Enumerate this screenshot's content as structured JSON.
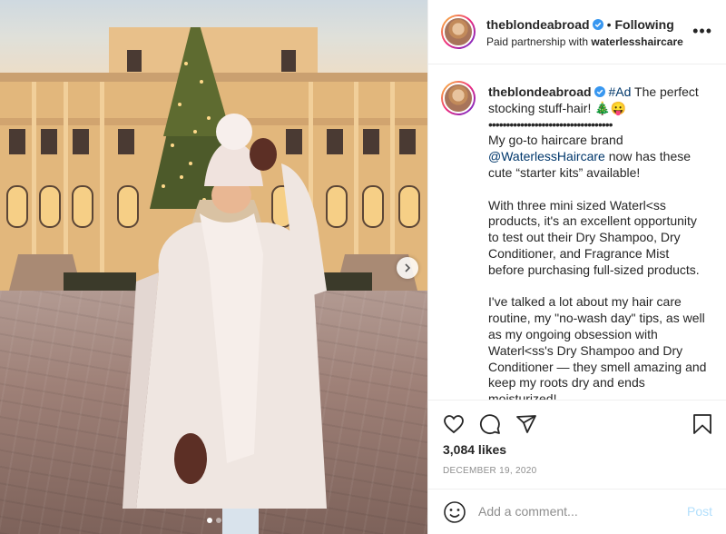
{
  "post": {
    "author": "theblondeabroad",
    "verified_icon": "verified-badge-icon",
    "separator": "•",
    "follow_status": "Following",
    "partnership_prefix": "Paid partnership with",
    "partner": "waterlesshaircare",
    "more_icon": "more-options-icon",
    "more_label": "•••"
  },
  "photo": {
    "icons": [
      "next-arrow-icon"
    ],
    "carousel_dots": 2,
    "active_dot": 0
  },
  "caption": {
    "author": "theblondeabroad",
    "hashtag": "#Ad",
    "line1_rest": " The perfect stocking stuff-hair! 🎄😛",
    "divider": "•••••••••••••••••••••••••••••••••••",
    "p1_before": "My go-to haircare brand ",
    "p1_mention": "@WaterlessHaircare",
    "p1_after": " now has these cute “starter kits” available!",
    "p2": "With three mini sized Waterl<ss products, it's an excellent opportunity to test out their Dry Shampoo, Dry Conditioner, and Fragrance Mist before purchasing full-sized products.",
    "p3": "I've talked a lot about my hair care routine, my \"no-wash day\" tips, as well as my ongoing obsession with Waterl<ss's Dry Shampoo and Dry Conditioner — they smell amazing and keep my roots dry and ends moisturized!"
  },
  "actions": {
    "icons": [
      "like-heart-icon",
      "comment-icon",
      "share-icon",
      "save-bookmark-icon"
    ],
    "likes": "3,084 likes",
    "date": "DECEMBER 19, 2020"
  },
  "comment": {
    "emoji_icon": "emoji-icon",
    "placeholder": "Add a comment...",
    "post_label": "Post"
  },
  "colors": {
    "link": "#00376b",
    "verified": "#3897f0",
    "muted": "#8e8e8e",
    "post_disabled": "#b2dffc",
    "border": "#efefef"
  }
}
